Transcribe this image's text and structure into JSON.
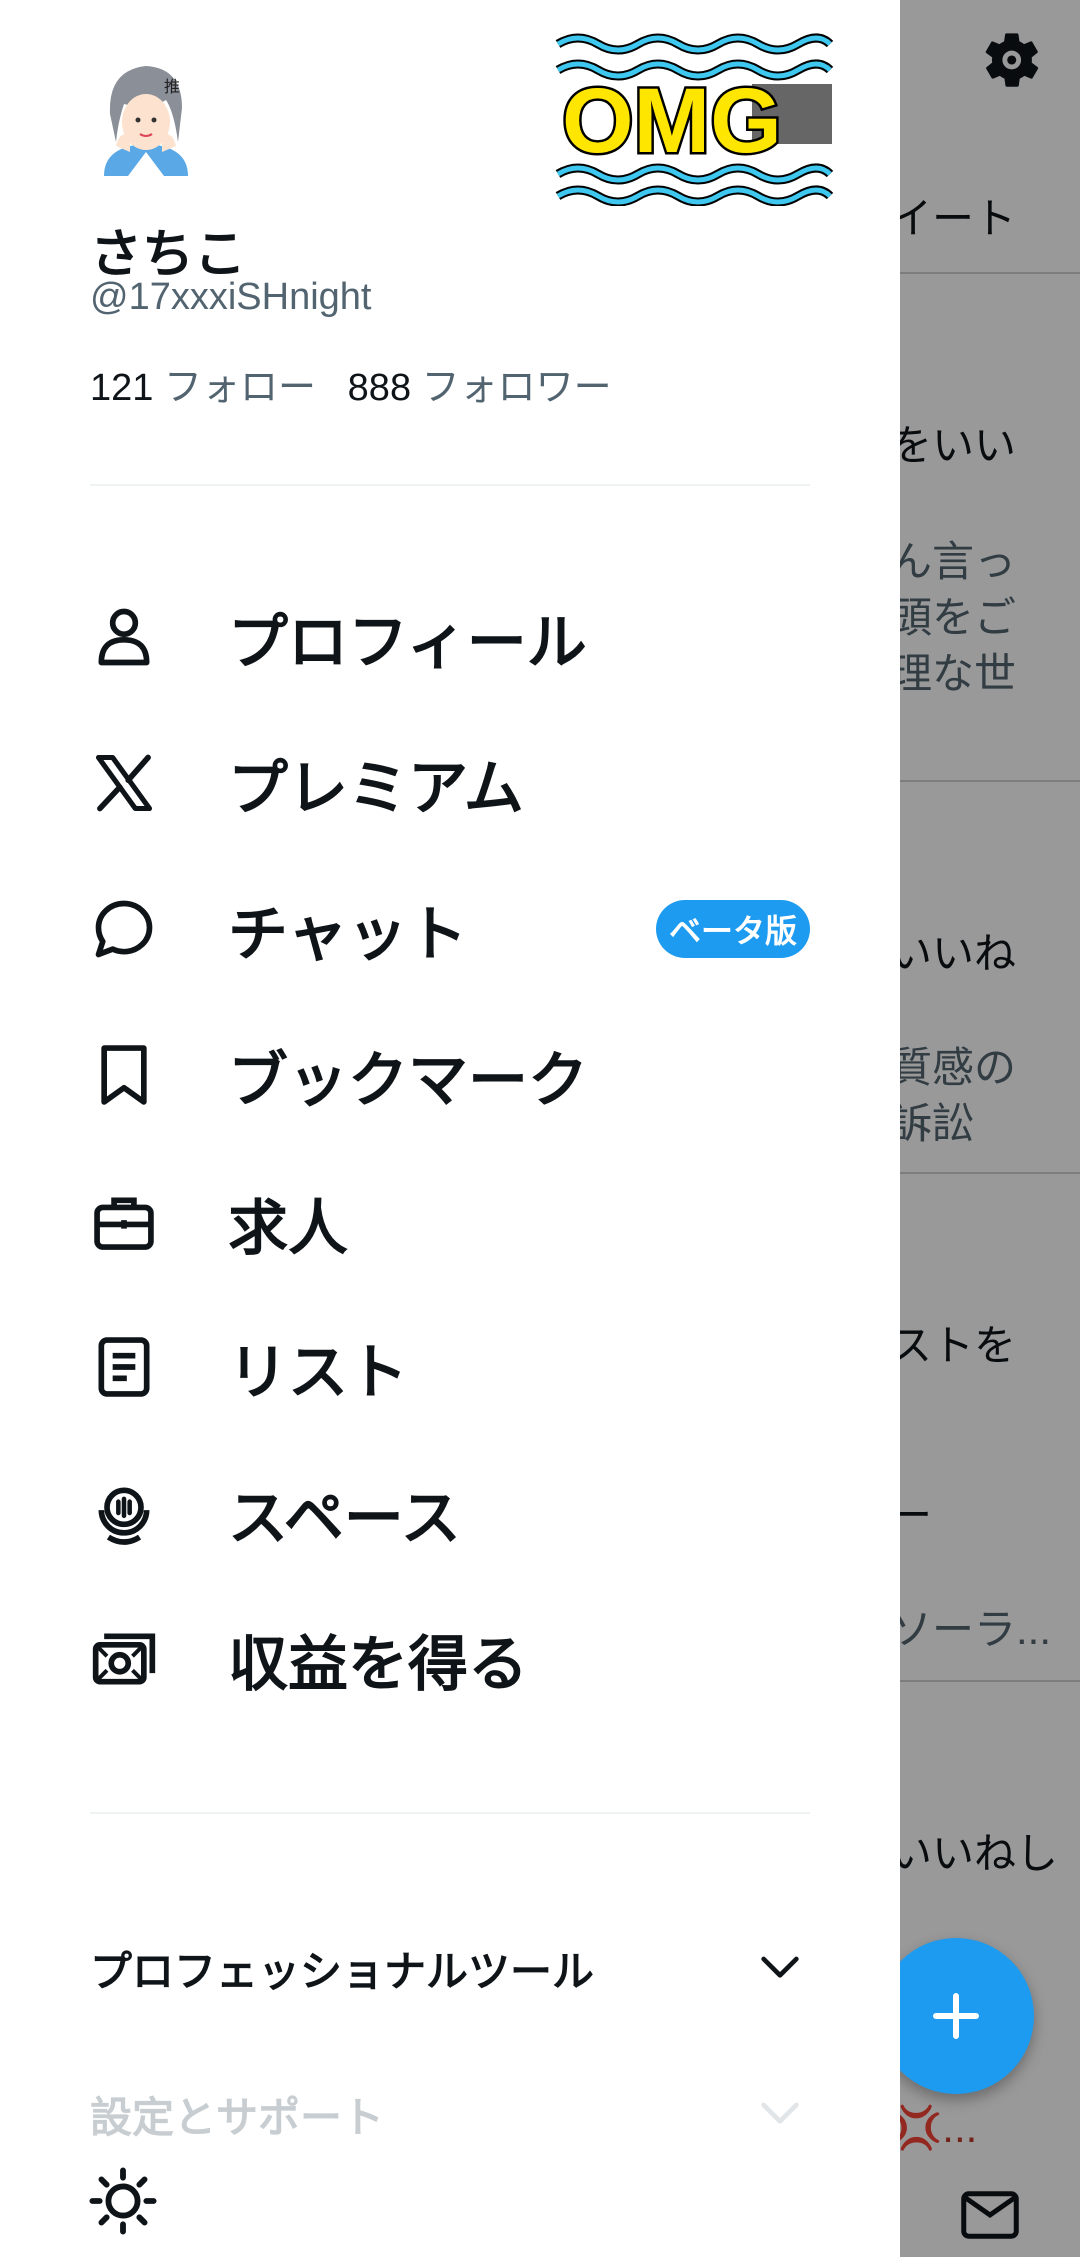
{
  "profile": {
    "display_name": "さちこ",
    "handle": "@17xxxiSHnight",
    "following_count": "121",
    "following_label": "フォロー",
    "followers_count": "888",
    "followers_label": "フォロワー",
    "sticker_text": "OMG",
    "avatar_badge": "推"
  },
  "menu": [
    {
      "label": "プロフィール",
      "icon": "person-icon"
    },
    {
      "label": "プレミアム",
      "icon": "x-logo-icon"
    },
    {
      "label": "チャット",
      "icon": "chat-bubble-icon",
      "badge": "ベータ版"
    },
    {
      "label": "ブックマーク",
      "icon": "bookmark-icon"
    },
    {
      "label": "求人",
      "icon": "briefcase-icon"
    },
    {
      "label": "リスト",
      "icon": "list-icon"
    },
    {
      "label": "スペース",
      "icon": "spaces-icon"
    },
    {
      "label": "収益を得る",
      "icon": "money-icon"
    }
  ],
  "sections": {
    "professional_tools": "プロフェッショナルツール",
    "settings_support": "設定とサポート"
  },
  "background": {
    "lines": [
      "イート",
      "をいい",
      "ん言っ",
      "頭をご",
      "理な世",
      "いいね",
      "質感の",
      "訴訟",
      "ストを",
      "ー",
      "ソーラ...",
      "いいねし",
      "💢..."
    ]
  },
  "colors": {
    "accent": "#1d9bf0",
    "text": "#0f1419",
    "secondary": "#536471"
  }
}
